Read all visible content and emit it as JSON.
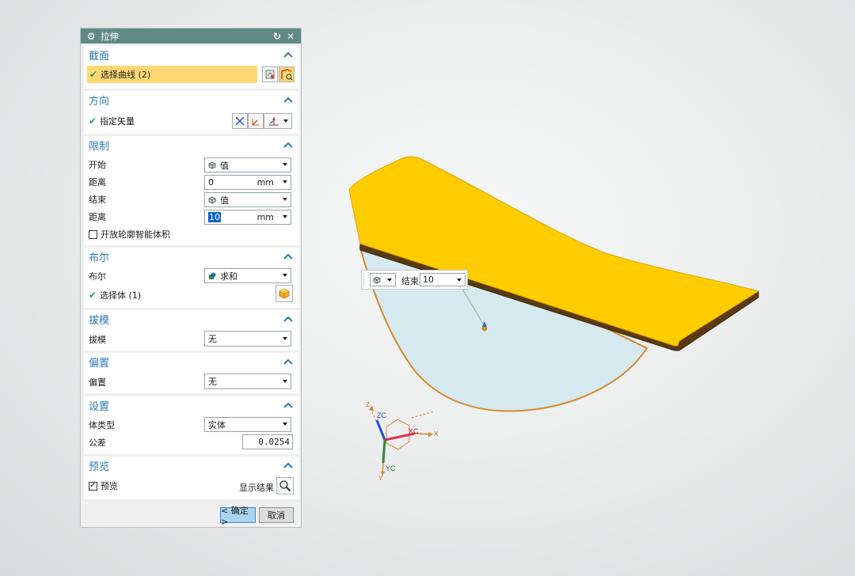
{
  "dialog": {
    "title": "拉伸",
    "sections": {
      "section": {
        "title": "截面",
        "select_curve": "选择曲线 (2)"
      },
      "direction": {
        "title": "方向",
        "specify_vector": "指定矢量"
      },
      "limits": {
        "title": "限制",
        "start_label": "开始",
        "start_value": "值",
        "start_distance_label": "距离",
        "start_distance": "0",
        "start_unit": "mm",
        "end_label": "结束",
        "end_value": "值",
        "end_distance_label": "距离",
        "end_distance": "10",
        "end_unit": "mm",
        "open_profile_label": "开放轮廓智能体积"
      },
      "boolean": {
        "title": "布尔",
        "bool_label": "布尔",
        "bool_value": "求和",
        "select_body": "选择体 (1)"
      },
      "draft": {
        "title": "拔模",
        "draft_label": "拔模",
        "draft_value": "无"
      },
      "offset": {
        "title": "偏置",
        "offset_label": "偏置",
        "offset_value": "无"
      },
      "settings": {
        "title": "设置",
        "body_type_label": "体类型",
        "body_type_value": "实体",
        "tolerance_label": "公差",
        "tolerance_value": "0.0254"
      },
      "preview": {
        "title": "预览",
        "preview_label": "预览",
        "show_result_label": "显示结果"
      }
    },
    "ok_label": "< 确定 >",
    "cancel_label": "取消"
  },
  "viewport_widget": {
    "end_label": "结束",
    "end_value": "10"
  },
  "triad": {
    "zc": "ZC",
    "xc": "XC",
    "yc": "YC",
    "z": "Z",
    "x": "X",
    "y": "Y"
  },
  "colors": {
    "title_bar": "#628a83",
    "section_header": "#2c7bb8",
    "selected_row": "#ffd873",
    "model_face": "#ffcc00",
    "sketch_fill": "#d6e9ef",
    "edge": "#d38a2a",
    "ok_button": "#a9d3ef"
  }
}
